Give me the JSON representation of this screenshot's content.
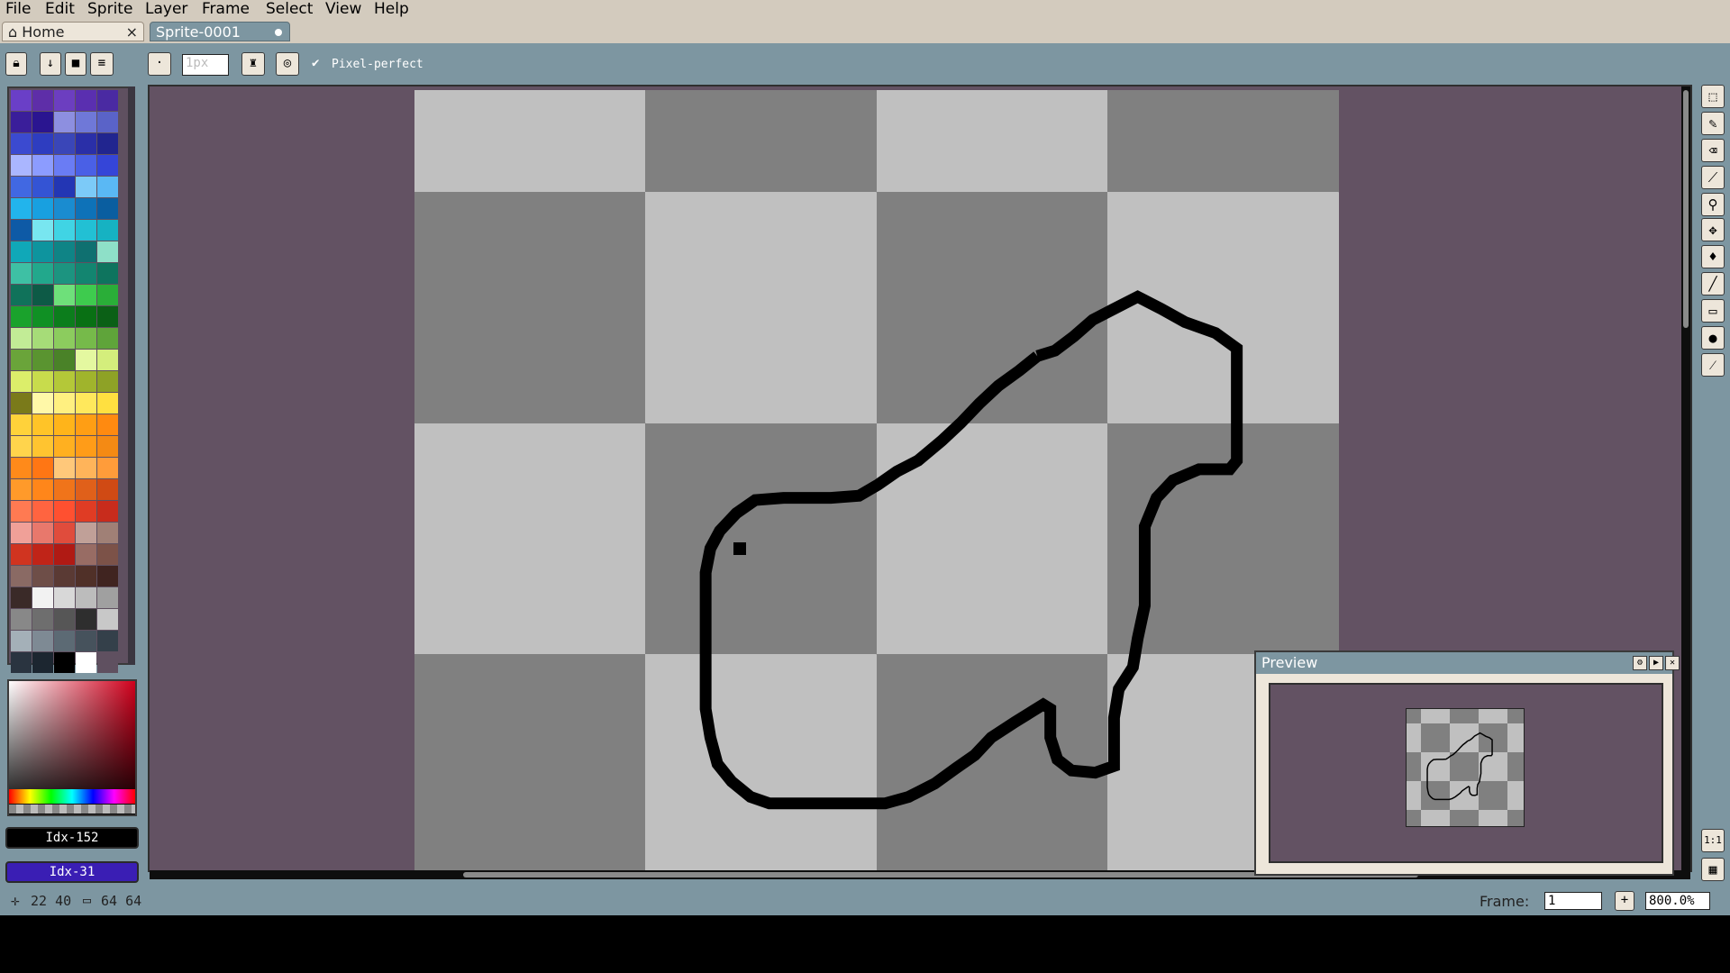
{
  "menu": [
    "File",
    "Edit",
    "Sprite",
    "Layer",
    "Frame",
    "Select",
    "View",
    "Help"
  ],
  "tabs": {
    "home": "Home",
    "home_close": "×",
    "sprite": "Sprite-0001"
  },
  "context_bar": {
    "brush_size": "1px",
    "pixel_perfect_label": "Pixel-perfect",
    "pixel_perfect_checked": true
  },
  "palette": {
    "colors": [
      "#6a3fc7",
      "#5e2ea8",
      "#6c3ec0",
      "#5a2fb0",
      "#4a2aa2",
      "#3a1e9a",
      "#2a1590",
      "#8d8fe0",
      "#6f78d8",
      "#5a63c8",
      "#3b4ad0",
      "#2e3dc0",
      "#3a46b8",
      "#2a2fa8",
      "#21258f",
      "#aab6ff",
      "#8c9cff",
      "#6a7cf4",
      "#4a60e6",
      "#3545d8",
      "#4168e2",
      "#3454d4",
      "#2336b4",
      "#7ccaf8",
      "#5ab8f4",
      "#22b4ec",
      "#18a0e0",
      "#1a8cd0",
      "#0e72b8",
      "#0a5ea0",
      "#0e5aa6",
      "#78e6f0",
      "#40d4e4",
      "#22c0d4",
      "#16b2c2",
      "#10a8b8",
      "#0e949e",
      "#0f8486",
      "#0f7070",
      "#8ee0c8",
      "#3ec0a4",
      "#22a88c",
      "#1c9480",
      "#138570",
      "#0e745e",
      "#10725a",
      "#0d5a46",
      "#6ee07a",
      "#3ecb4e",
      "#2aae38",
      "#1aa22c",
      "#109024",
      "#0c7d1c",
      "#097014",
      "#0b6016",
      "#c2ec96",
      "#a6dc78",
      "#8ccc5e",
      "#76ba4a",
      "#5fa43a",
      "#6aa43a",
      "#5a9430",
      "#4a8228",
      "#e4f8a0",
      "#d4ee7c",
      "#dcee6a",
      "#c8dc4c",
      "#b4c838",
      "#a0b42c",
      "#8ea226",
      "#7a7a1a",
      "#fff8a8",
      "#fff080",
      "#ffe85c",
      "#ffe040",
      "#ffd23a",
      "#ffc428",
      "#ffb41a",
      "#ff9e14",
      "#ff8a10",
      "#ffd44c",
      "#ffc430",
      "#ffb020",
      "#ff9c18",
      "#f48a14",
      "#ff8a1a",
      "#ff7614",
      "#ffc87a",
      "#ffb45a",
      "#ff9c3a",
      "#ff9a2a",
      "#ff861a",
      "#f0741a",
      "#e0601a",
      "#d04a14",
      "#ff7a52",
      "#ff6440",
      "#ff5030",
      "#e03c24",
      "#c82c1c",
      "#f0a098",
      "#e8786c",
      "#e04c3c",
      "#c0a098",
      "#a08076",
      "#d03420",
      "#c02418",
      "#b01a14",
      "#986c64",
      "#7c5248",
      "#8a6a64",
      "#6e4e48",
      "#5a3a34",
      "#503028",
      "#402420",
      "#3a2a28",
      "#f2f2f2",
      "#d8d8d8",
      "#bcbcbc",
      "#a0a0a0",
      "#888888",
      "#6e6e6e",
      "#565656",
      "#2e2e2e",
      "#c8c8c8",
      "#a4b0b8",
      "#7e8a94",
      "#5c6a74",
      "#46525c",
      "#34404a",
      "#2a3440",
      "#1c2630",
      "#000000",
      "#ffffff",
      "#5f5060"
    ]
  },
  "fg_color": {
    "label": "Idx-152",
    "hex": "#000000"
  },
  "bg_color": {
    "label": "Idx-31",
    "hex": "#3a1eb4"
  },
  "preview": {
    "title": "Preview"
  },
  "status": {
    "cursor": "22 40",
    "size": "64 64",
    "frame_label": "Frame:",
    "frame_value": "1",
    "add_frame": "+",
    "zoom": "800.0%"
  },
  "sidebar_right": {
    "ratio_label": "1:1"
  }
}
